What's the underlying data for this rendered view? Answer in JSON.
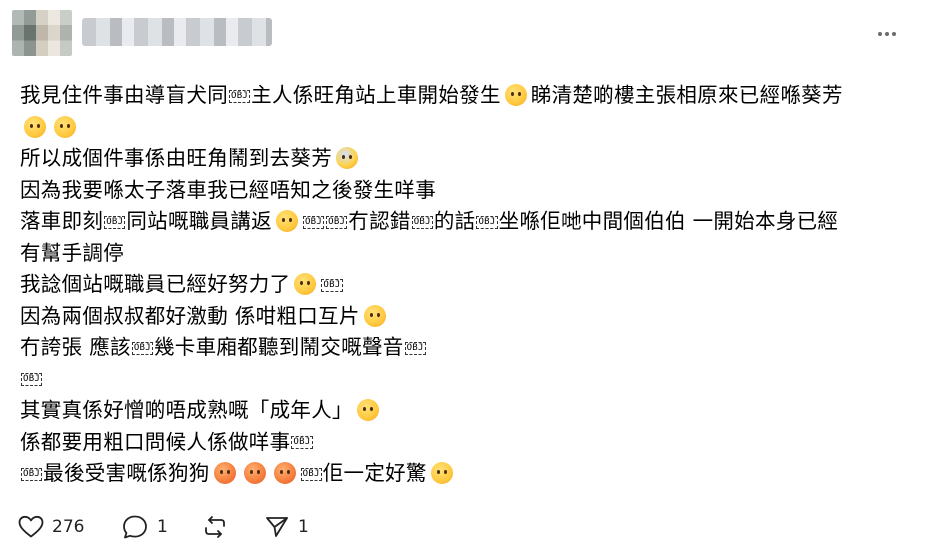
{
  "post": {
    "lines": [
      [
        "我見住件事由導盲犬同",
        "{OBJ}",
        "主人係旺角站上車開始發生",
        "{E:cry}",
        "睇清楚啲樓主張相原來已經喺葵芳"
      ],
      [
        "{E:cry}",
        "{E:cry}"
      ],
      [
        "所以成個件事係由旺角鬧到去葵芳",
        "{E:scream}"
      ],
      [
        "因為我要喺太子落車我已經唔知之後發生咩事"
      ],
      [
        "落車即刻",
        "{OBJ}",
        "同站嘅職員講返",
        "{E:peek}",
        "{OBJ}",
        "{OBJ}",
        "冇認錯",
        "{OBJ}",
        "的話",
        "{OBJ}",
        "坐喺佢哋中間個伯伯 一開始本身已經"
      ],
      [
        "有幫手調停"
      ],
      [
        "我諗個站嘅職員已經好努力了",
        "{E:grimace}",
        "{OBJ}"
      ],
      [
        "因為兩個叔叔都好激動 係咁粗口互片",
        "{E:cry}"
      ],
      [
        "冇誇張 應該",
        "{OBJ}",
        "幾卡車廂都聽到鬧交嘅聲音",
        "{OBJ}"
      ],
      [
        "{OBJ}"
      ],
      [
        "其實真係好憎啲唔成熟嘅「成年人」",
        "{E:flushed}"
      ],
      [
        "係都要用粗口問候人係做咩事",
        "{OBJ}"
      ],
      [
        "{OBJ}",
        "最後受害嘅係狗狗",
        "{E:red}",
        "{E:red}",
        "{E:red}",
        "{OBJ}",
        "佢一定好驚",
        "{E:grimace}"
      ]
    ],
    "obj_glyph": "OBJ"
  },
  "actions": {
    "like_count": "276",
    "comment_count": "1",
    "repost_count": "",
    "share_count": "1"
  },
  "icons": {
    "more": "more-horizontal-icon",
    "like": "heart-icon",
    "comment": "comment-bubble-icon",
    "repost": "repost-icon",
    "share": "send-icon"
  }
}
